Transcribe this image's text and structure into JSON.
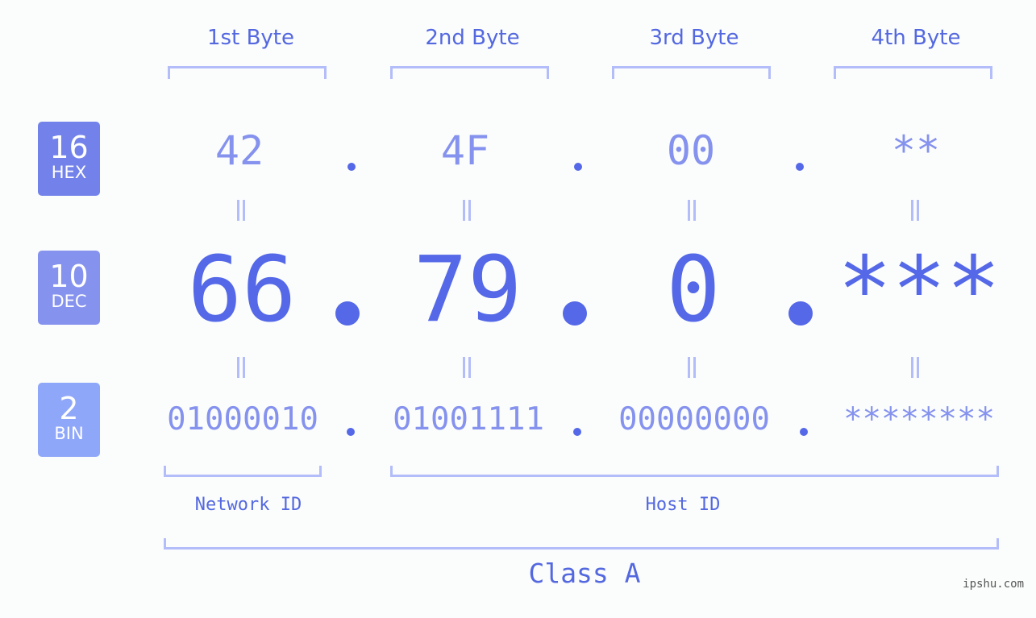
{
  "byte_headers": [
    "1st Byte",
    "2nd Byte",
    "3rd Byte",
    "4th Byte"
  ],
  "badges": {
    "hex": {
      "num": "16",
      "label": "HEX",
      "color": "#7282ea"
    },
    "dec": {
      "num": "10",
      "label": "DEC",
      "color": "#8592ee"
    },
    "bin": {
      "num": "2",
      "label": "BIN",
      "color": "#8fa7f8"
    }
  },
  "hex": [
    "42",
    "4F",
    "00",
    "**"
  ],
  "dec": [
    "66",
    "79",
    "0",
    "***"
  ],
  "bin": [
    "01000010",
    "01001111",
    "00000000",
    "********"
  ],
  "network_id_label": "Network ID",
  "host_id_label": "Host ID",
  "class_label": "Class A",
  "watermark": "ipshu.com",
  "colors": {
    "accent": "#5468e8",
    "light_accent": "#8592ee",
    "bracket": "#b3bdf9",
    "background": "#fbfdfc"
  }
}
